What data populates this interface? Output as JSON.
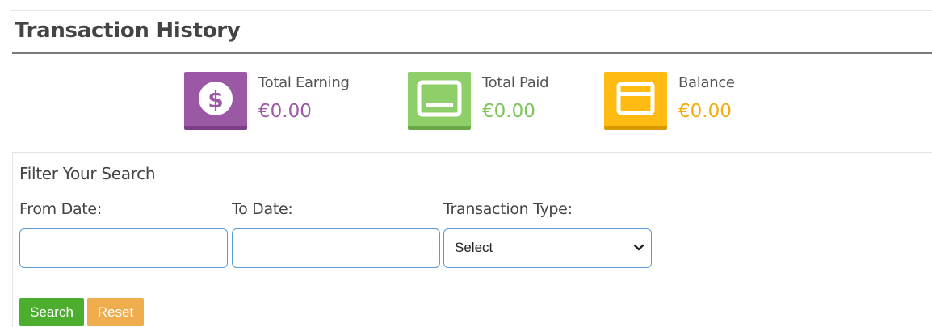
{
  "page": {
    "title": "Transaction History"
  },
  "stats": {
    "total_earning": {
      "label": "Total Earning",
      "value": "€0.00",
      "icon": "dollar-circle-icon",
      "color": "#9b59a5"
    },
    "total_paid": {
      "label": "Total Paid",
      "value": "€0.00",
      "icon": "payment-card-icon",
      "color": "#8fcf6a"
    },
    "balance": {
      "label": "Balance",
      "value": "€0.00",
      "icon": "wallet-card-icon",
      "color": "#ffbb11"
    }
  },
  "filter": {
    "heading": "Filter Your Search",
    "from_date": {
      "label": "From Date:",
      "value": "",
      "placeholder": ""
    },
    "to_date": {
      "label": "To Date:",
      "value": "",
      "placeholder": ""
    },
    "transaction_type": {
      "label": "Transaction Type:",
      "selected": "Select"
    },
    "buttons": {
      "search_label": "Search",
      "reset_label": "Reset"
    }
  },
  "colors": {
    "search_button": "#4cae2e",
    "reset_button": "#f0ad4e",
    "input_border": "#5b9bd5"
  }
}
